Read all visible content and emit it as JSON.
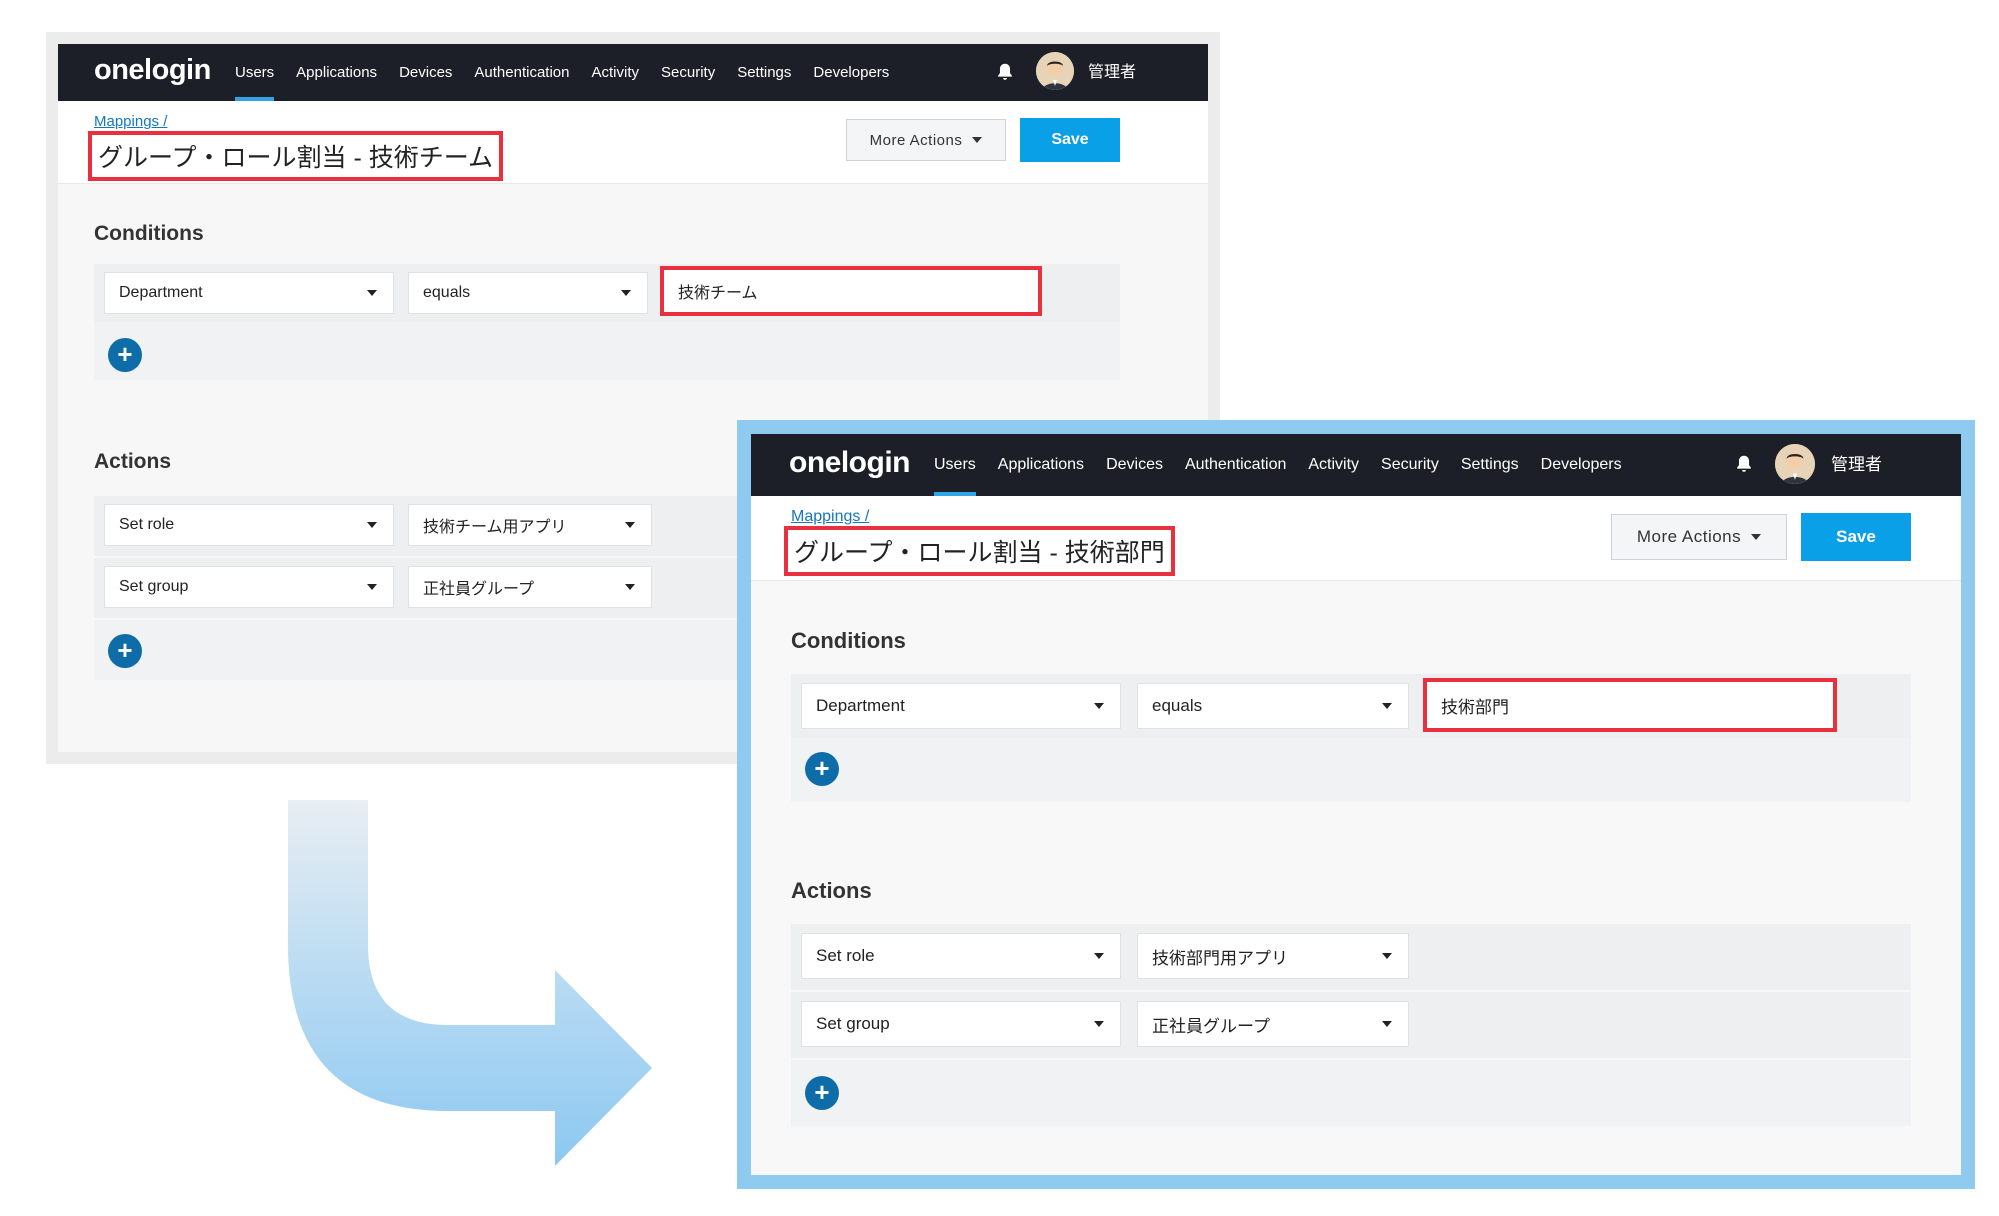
{
  "nav": {
    "logo": "onelogin",
    "items": [
      {
        "label": "Users",
        "active": true
      },
      {
        "label": "Applications",
        "active": false
      },
      {
        "label": "Devices",
        "active": false
      },
      {
        "label": "Authentication",
        "active": false
      },
      {
        "label": "Activity",
        "active": false
      },
      {
        "label": "Security",
        "active": false
      },
      {
        "label": "Settings",
        "active": false
      },
      {
        "label": "Developers",
        "active": false
      }
    ],
    "username": "管理者"
  },
  "before": {
    "breadcrumb": "Mappings /",
    "title": "グループ・ロール割当 - 技術チーム",
    "more_actions": "More Actions",
    "save": "Save",
    "conditions_title": "Conditions",
    "condition": {
      "field": "Department",
      "operator": "equals",
      "value": "技術チーム"
    },
    "actions_title": "Actions",
    "actions": [
      {
        "action": "Set role",
        "value": "技術チーム用アプリ"
      },
      {
        "action": "Set group",
        "value": "正社員グループ"
      }
    ]
  },
  "after": {
    "breadcrumb": "Mappings /",
    "title": "グループ・ロール割当 - 技術部門",
    "more_actions": "More Actions",
    "save": "Save",
    "conditions_title": "Conditions",
    "condition": {
      "field": "Department",
      "operator": "equals",
      "value": "技術部門"
    },
    "actions_title": "Actions",
    "actions": [
      {
        "action": "Set role",
        "value": "技術部門用アプリ"
      },
      {
        "action": "Set group",
        "value": "正社員グループ"
      }
    ]
  },
  "colors": {
    "nav_bg": "#1c1f27",
    "accent": "#0aa0e8",
    "highlight_red": "#e8303f",
    "after_frame": "#8fcaf1",
    "plus_button": "#0e6da8"
  }
}
